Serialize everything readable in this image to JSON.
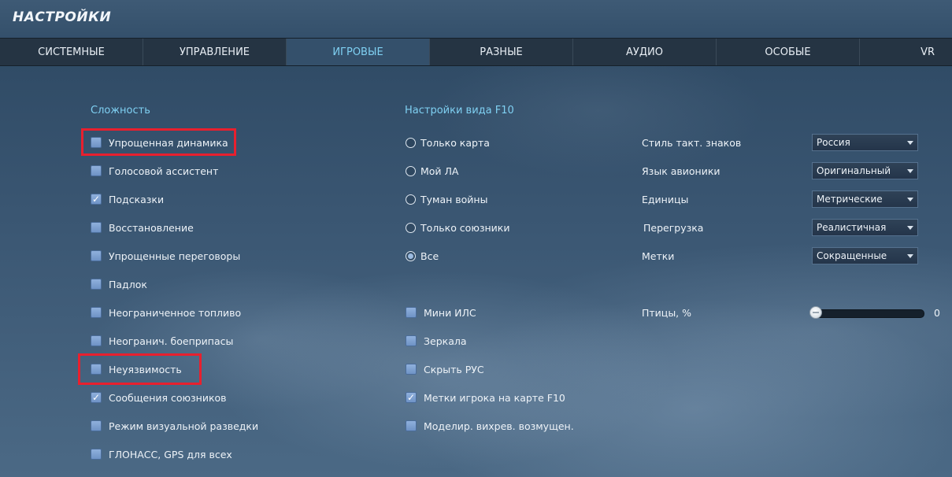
{
  "window": {
    "title": "НАСТРОЙКИ"
  },
  "tabs": [
    {
      "label": "СИСТЕМНЫЕ",
      "active": false
    },
    {
      "label": "УПРАВЛЕНИЕ",
      "active": false
    },
    {
      "label": "ИГРОВЫЕ",
      "active": true
    },
    {
      "label": "РАЗНЫЕ",
      "active": false
    },
    {
      "label": "АУДИО",
      "active": false
    },
    {
      "label": "ОСОБЫЕ",
      "active": false
    },
    {
      "label": "VR",
      "active": false
    }
  ],
  "difficulty": {
    "title": "Сложность",
    "options": [
      {
        "label": "Упрощенная динамика",
        "checked": false
      },
      {
        "label": "Голосовой ассистент",
        "checked": false
      },
      {
        "label": "Подсказки",
        "checked": true
      },
      {
        "label": "Восстановление",
        "checked": false
      },
      {
        "label": "Упрощенные переговоры",
        "checked": false
      },
      {
        "label": "Падлок",
        "checked": false
      },
      {
        "label": "Неограниченное топливо",
        "checked": false
      },
      {
        "label": "Неогранич. боеприпасы",
        "checked": false
      },
      {
        "label": "Неуязвимость",
        "checked": false
      },
      {
        "label": "Сообщения союзников",
        "checked": true
      },
      {
        "label": "Режим визуальной разведки",
        "checked": false
      },
      {
        "label": "ГЛОНАСС, GPS для всех",
        "checked": false
      }
    ]
  },
  "f10_view": {
    "title": "Настройки вида F10",
    "options": [
      {
        "label": "Только карта",
        "selected": false
      },
      {
        "label": "Мой ЛА",
        "selected": false
      },
      {
        "label": "Туман войны",
        "selected": false
      },
      {
        "label": "Только союзники",
        "selected": false
      },
      {
        "label": "Все",
        "selected": true
      }
    ]
  },
  "misc": {
    "options": [
      {
        "label": "Мини ИЛС",
        "checked": false
      },
      {
        "label": "Зеркала",
        "checked": false
      },
      {
        "label": "Скрыть РУС",
        "checked": false
      },
      {
        "label": "Метки игрока на карте F10",
        "checked": true
      },
      {
        "label": "Моделир. вихрев. возмущен.",
        "checked": false
      }
    ]
  },
  "dropdowns": [
    {
      "label": "Стиль такт. знаков",
      "value": "Россия"
    },
    {
      "label": "Язык авионики",
      "value": "Оригинальный"
    },
    {
      "label": "Единицы",
      "value": "Метрические"
    },
    {
      "label": "Перегрузка",
      "value": "Реалистичная"
    },
    {
      "label": "Метки",
      "value": "Сокращенные"
    }
  ],
  "birds": {
    "label": "Птицы, %",
    "value": "0",
    "fraction": 0
  },
  "colors": {
    "accent": "#7fd0f2",
    "highlight": "#e8202e",
    "checkbox": "#7fa2d2"
  }
}
